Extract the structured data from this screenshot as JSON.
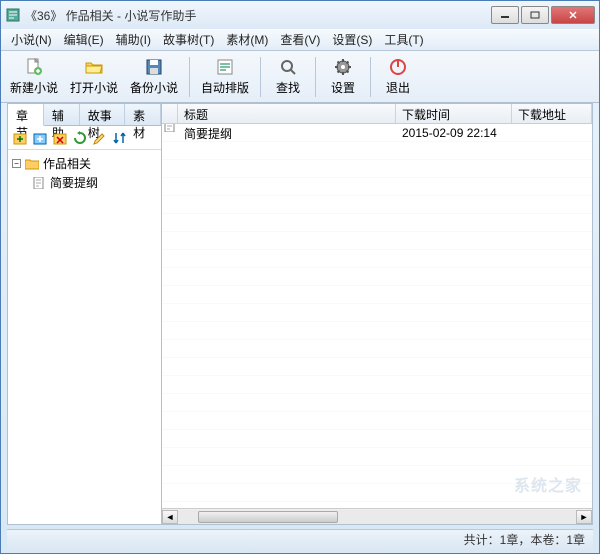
{
  "title": "《36》 作品相关 - 小说写作助手",
  "menus": {
    "novel": "小说(N)",
    "edit": "编辑(E)",
    "assist": "辅助(I)",
    "storytree": "故事树(T)",
    "material": "素材(M)",
    "view": "查看(V)",
    "settings": "设置(S)",
    "tools": "工具(T)"
  },
  "toolbar": {
    "new": "新建小说",
    "open": "打开小说",
    "backup": "备份小说",
    "layout": "自动排版",
    "find": "查找",
    "settings": "设置",
    "exit": "退出"
  },
  "tabs": {
    "chapter": "章节",
    "assist": "辅助",
    "storytree": "故事树",
    "material": "素材"
  },
  "tree": {
    "root": "作品相关",
    "child1": "简要提纲"
  },
  "columns": {
    "title": "标题",
    "downloadTime": "下载时间",
    "downloadUrl": "下载地址"
  },
  "row1": {
    "title": "简要提纲",
    "time": "2015-02-09 22:14",
    "url": ""
  },
  "status": "共计：1章，本卷：1章",
  "watermark": "系统之家"
}
